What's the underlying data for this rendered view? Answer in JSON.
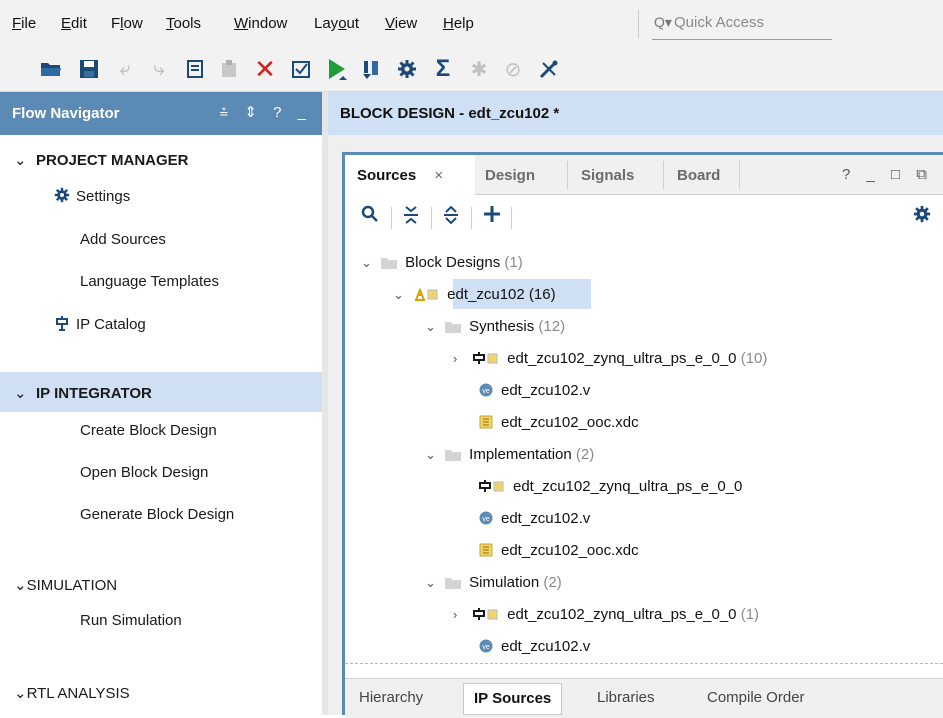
{
  "menubar": {
    "items": [
      {
        "pre": "",
        "u": "F",
        "post": "ile"
      },
      {
        "pre": "",
        "u": "E",
        "post": "dit"
      },
      {
        "pre": "F",
        "u": "l",
        "post": "ow"
      },
      {
        "pre": "",
        "u": "T",
        "post": "ools"
      },
      {
        "pre": "",
        "u": "W",
        "post": "indow"
      },
      {
        "pre": "Lay",
        "u": "o",
        "post": "ut"
      },
      {
        "pre": "",
        "u": "V",
        "post": "iew"
      },
      {
        "pre": "",
        "u": "H",
        "post": "elp"
      }
    ],
    "quick_access": "Quick Access"
  },
  "flow_navigator": {
    "title": "Flow Navigator",
    "controls": "⩮ ⇕ ? _",
    "project_manager": {
      "label": "PROJECT MANAGER",
      "settings": "Settings",
      "add_sources": "Add Sources",
      "language_templates": "Language Templates",
      "ip_catalog": "IP Catalog"
    },
    "ip_integrator": {
      "label": "IP INTEGRATOR",
      "create": "Create Block Design",
      "open": "Open Block Design",
      "generate": "Generate Block Design"
    },
    "simulation": {
      "label": "SIMULATION",
      "run": "Run Simulation"
    },
    "rtl_analysis": {
      "label": "RTL ANALYSIS"
    }
  },
  "block_design": {
    "header": "BLOCK DESIGN - edt_zcu102 *"
  },
  "sources": {
    "tabs": [
      "Sources",
      "Design",
      "Signals",
      "Board"
    ],
    "tab_close": "×",
    "window_controls": "? _ □ ⧉",
    "tree": {
      "block_designs": {
        "label": "Block Designs",
        "count": "(1)"
      },
      "edt": {
        "label": "edt_zcu102",
        "count": "(16)"
      },
      "synthesis": {
        "label": "Synthesis",
        "count": "(12)"
      },
      "syn_ip": {
        "label": "edt_zcu102_zynq_ultra_ps_e_0_0",
        "count": "(10)"
      },
      "syn_v": {
        "label": "edt_zcu102.v"
      },
      "syn_xdc": {
        "label": "edt_zcu102_ooc.xdc"
      },
      "implementation": {
        "label": "Implementation",
        "count": "(2)"
      },
      "imp_ip": {
        "label": "edt_zcu102_zynq_ultra_ps_e_0_0"
      },
      "imp_v": {
        "label": "edt_zcu102.v"
      },
      "imp_xdc": {
        "label": "edt_zcu102_ooc.xdc"
      },
      "simulation": {
        "label": "Simulation",
        "count": "(2)"
      },
      "sim_ip": {
        "label": "edt_zcu102_zynq_ultra_ps_e_0_0",
        "count": "(1)"
      },
      "sim_v": {
        "label": "edt_zcu102.v"
      }
    },
    "bottom_tabs": [
      "Hierarchy",
      "IP Sources",
      "Libraries",
      "Compile Order"
    ]
  },
  "colors": {
    "navigator_header": "#5b8bb5",
    "selection": "#cfe0f4",
    "stop_red": "#d91e18",
    "run_green": "#1e9e3a"
  }
}
